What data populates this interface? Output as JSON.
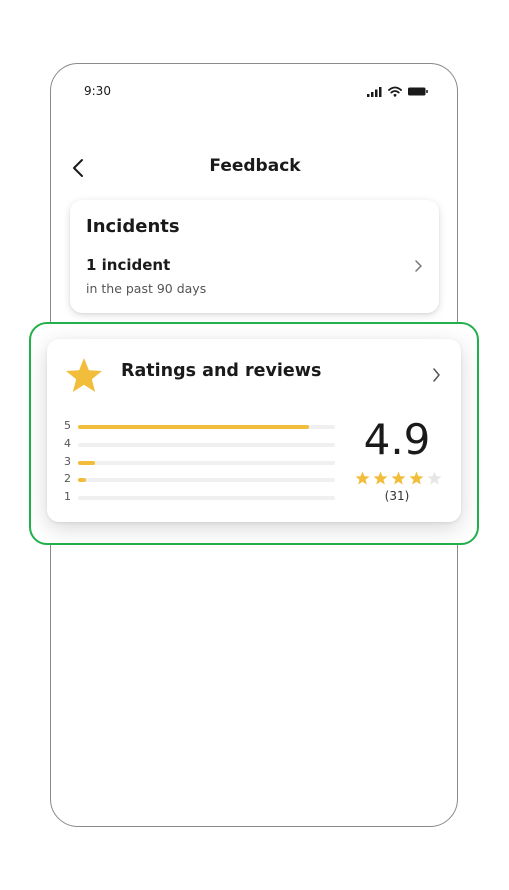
{
  "status_bar": {
    "time": "9:30"
  },
  "nav": {
    "title": "Feedback"
  },
  "incidents": {
    "title": "Incidents",
    "count_label": "1 incident",
    "period_label": "in the past 90 days"
  },
  "ratings": {
    "title": "Ratings and reviews",
    "score": "4.9",
    "review_count": "(31)",
    "stars_filled": 4,
    "stars_total": 5,
    "distribution": [
      {
        "label": "5",
        "fraction": 0.9
      },
      {
        "label": "4",
        "fraction": 0.0
      },
      {
        "label": "3",
        "fraction": 0.065
      },
      {
        "label": "2",
        "fraction": 0.03
      },
      {
        "label": "1",
        "fraction": 0.0
      }
    ]
  },
  "colors": {
    "accent_star": "#f2bd3a",
    "highlight_border": "#21b04b",
    "empty_star": "#e6e6e6"
  },
  "icons": {
    "back": "chevron-left-icon",
    "row_chevron": "chevron-right-icon",
    "rating": "star-icon",
    "signal": "signal-icon",
    "wifi": "wifi-icon",
    "battery": "battery-icon"
  }
}
